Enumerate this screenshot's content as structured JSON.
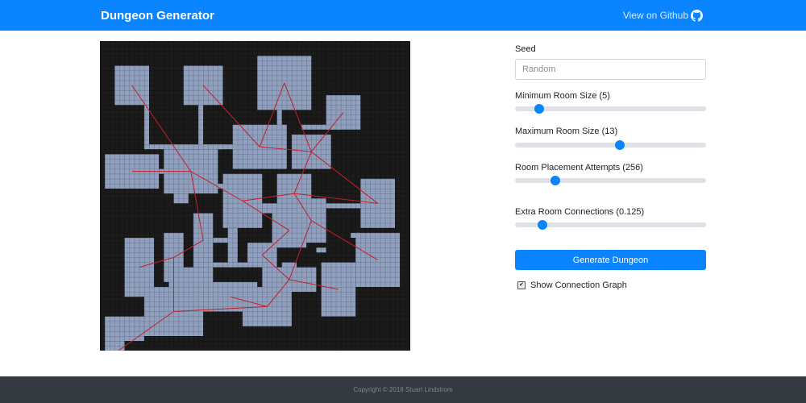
{
  "navbar": {
    "brand": "Dungeon Generator",
    "github_label": "View on Github",
    "github_icon": "github-icon",
    "color": "#0a84ff"
  },
  "dungeon": {
    "background_color": "#1b1b1b",
    "room_color": "#8f9fbd",
    "connection_color": "#c81d2a",
    "show_connection_graph": true
  },
  "controls": {
    "seed_label": "Seed",
    "seed_placeholder": "Random",
    "seed_value": "",
    "min_room_label": "Minimum Room Size (5)",
    "min_room_value": 5,
    "max_room_label": "Maximum Room Size (13)",
    "max_room_value": 13,
    "placement_label": "Room Placement Attempts (256)",
    "placement_value": 256,
    "extra_conn_label": "Extra Room Connections (0.125)",
    "extra_conn_value": 0.125,
    "generate_label": "Generate Dungeon",
    "show_graph_label": "Show Connection Graph",
    "show_graph_checked": true,
    "accent_color": "#0a84ff"
  },
  "footer": {
    "copyright": "Copyright © 2018 Stuart Lindstrom"
  }
}
